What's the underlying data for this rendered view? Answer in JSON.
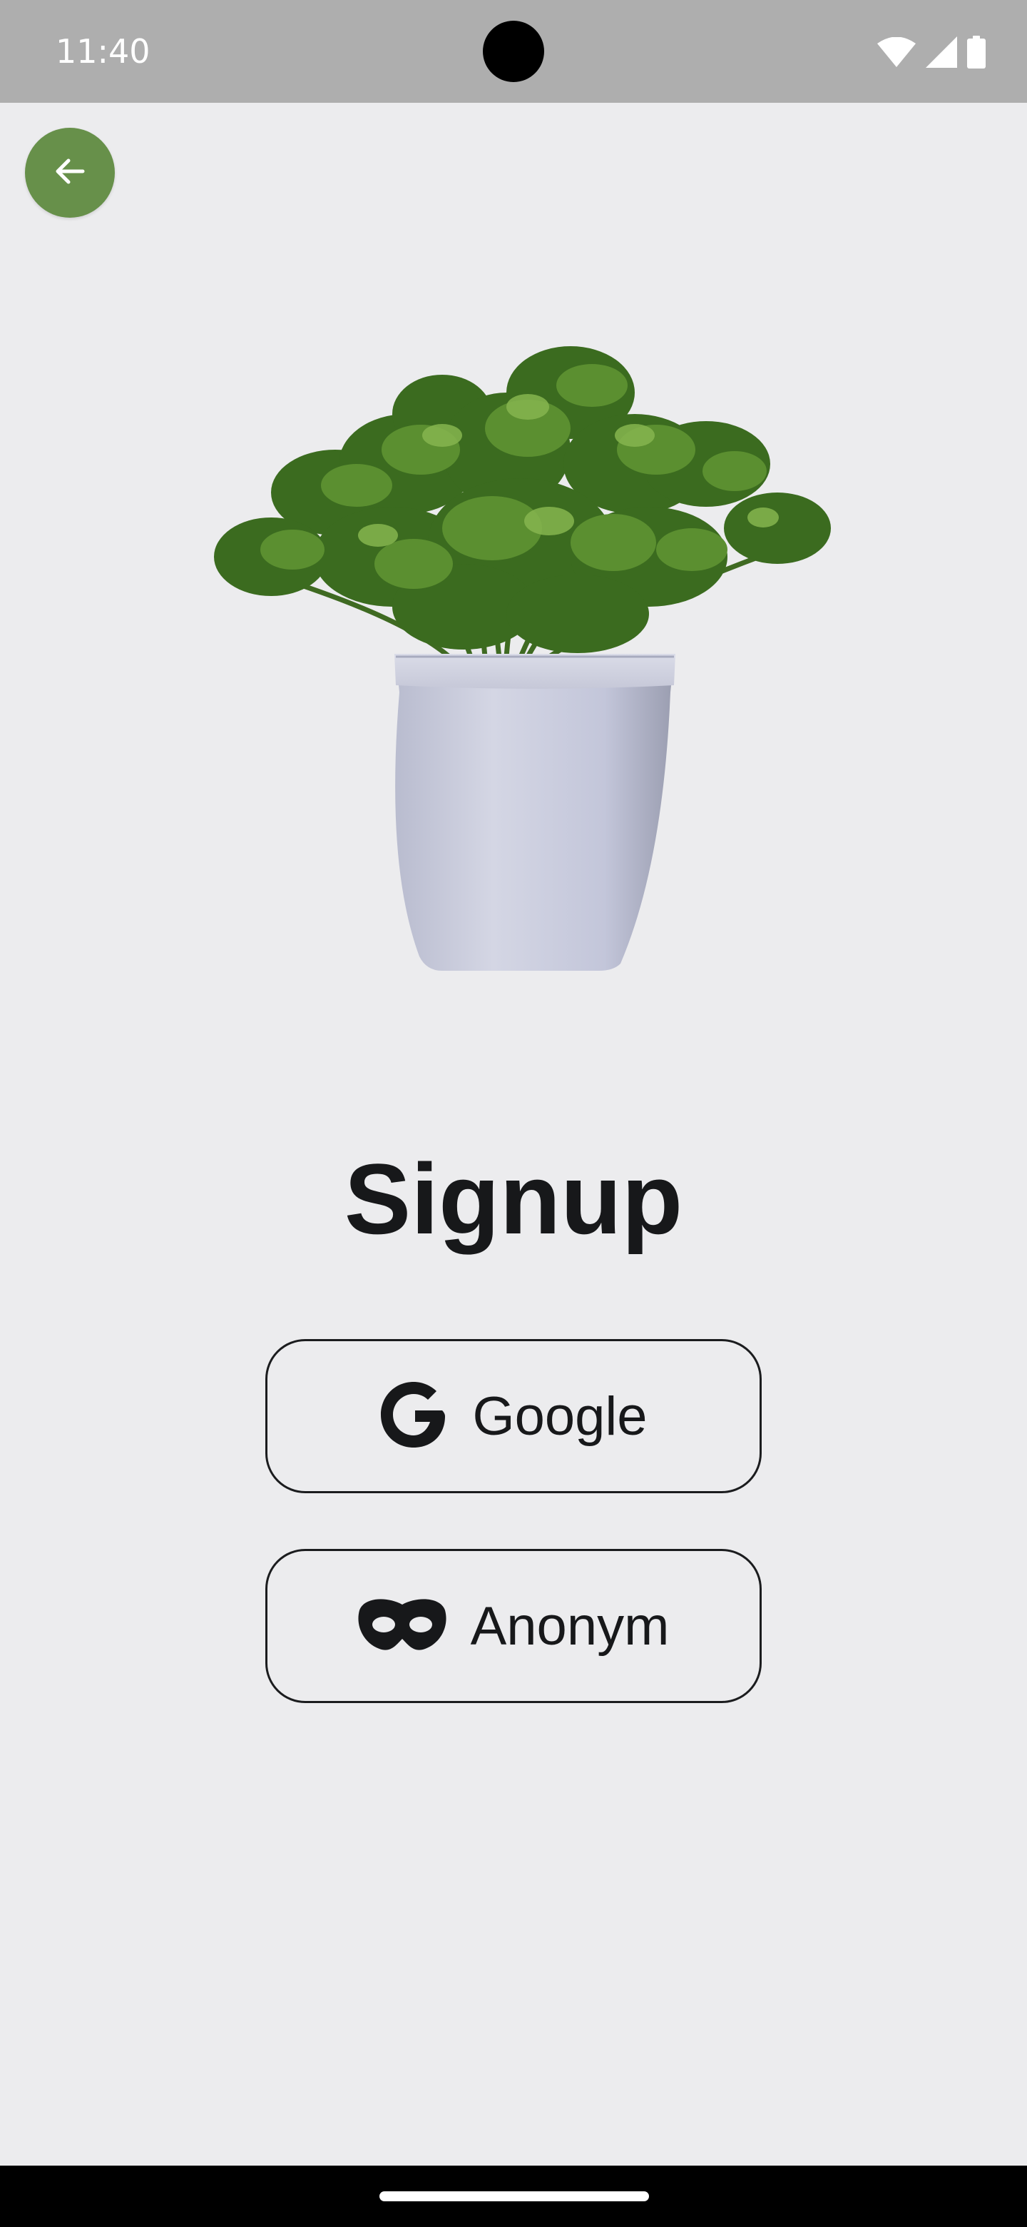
{
  "status_bar": {
    "time": "11:40",
    "icons": [
      "wifi-icon",
      "cell-signal-icon",
      "battery-icon"
    ]
  },
  "header": {
    "back_icon": "arrow-left-icon",
    "accent_color": "#67904A"
  },
  "illustration": {
    "subject": "potted-plant-image"
  },
  "main": {
    "title": "Signup",
    "buttons": [
      {
        "label": "Google",
        "icon": "google-icon"
      },
      {
        "label": "Anonym",
        "icon": "mask-icon"
      }
    ]
  },
  "colors": {
    "background": "#ECECEE",
    "text": "#17181A",
    "status_bar": "#AEAEAE"
  }
}
